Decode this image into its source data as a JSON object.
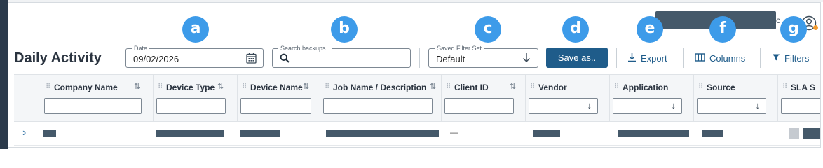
{
  "header": {
    "suffix_text": "c",
    "icons": {
      "user": "user-circle-icon",
      "notification": "notification-dot-icon"
    },
    "colors": {
      "masked": "#45596a",
      "accent_dot": "#f29a2e"
    }
  },
  "callouts": [
    "a",
    "b",
    "c",
    "d",
    "e",
    "f",
    "g"
  ],
  "page": {
    "title": "Daily Activity"
  },
  "toolbar": {
    "date": {
      "legend": "Date",
      "value": "09/02/2026",
      "icon": "calendar-icon"
    },
    "search": {
      "placeholder": "Search backups..",
      "value": "",
      "icon": "search-icon"
    },
    "saved_filter": {
      "legend": "Saved Filter Set",
      "value": "Default",
      "icon": "chevron-down-icon"
    },
    "save_as_label": "Save as..",
    "export_label": "Export",
    "columns_label": "Columns",
    "filters_label": "Filters"
  },
  "grid": {
    "columns": [
      {
        "label": "Company Name",
        "sortable": true,
        "filter": "text"
      },
      {
        "label": "Device Type",
        "sortable": true,
        "filter": "text"
      },
      {
        "label": "Device Name",
        "sortable": true,
        "filter": "text"
      },
      {
        "label": "Job Name / Description",
        "sortable": true,
        "filter": "text"
      },
      {
        "label": "Client ID",
        "sortable": true,
        "filter": "text"
      },
      {
        "label": "Vendor",
        "sortable": false,
        "filter": "select"
      },
      {
        "label": "Application",
        "sortable": false,
        "filter": "select"
      },
      {
        "label": "Source",
        "sortable": false,
        "filter": "select"
      },
      {
        "label": "SLA S",
        "sortable": false,
        "filter": "text"
      }
    ],
    "rows": [
      {
        "client_id": "—",
        "masked": true
      }
    ]
  },
  "colors": {
    "primary": "#1f5c8a",
    "callout": "#3d9be9",
    "masked_cell": "#45596a"
  }
}
